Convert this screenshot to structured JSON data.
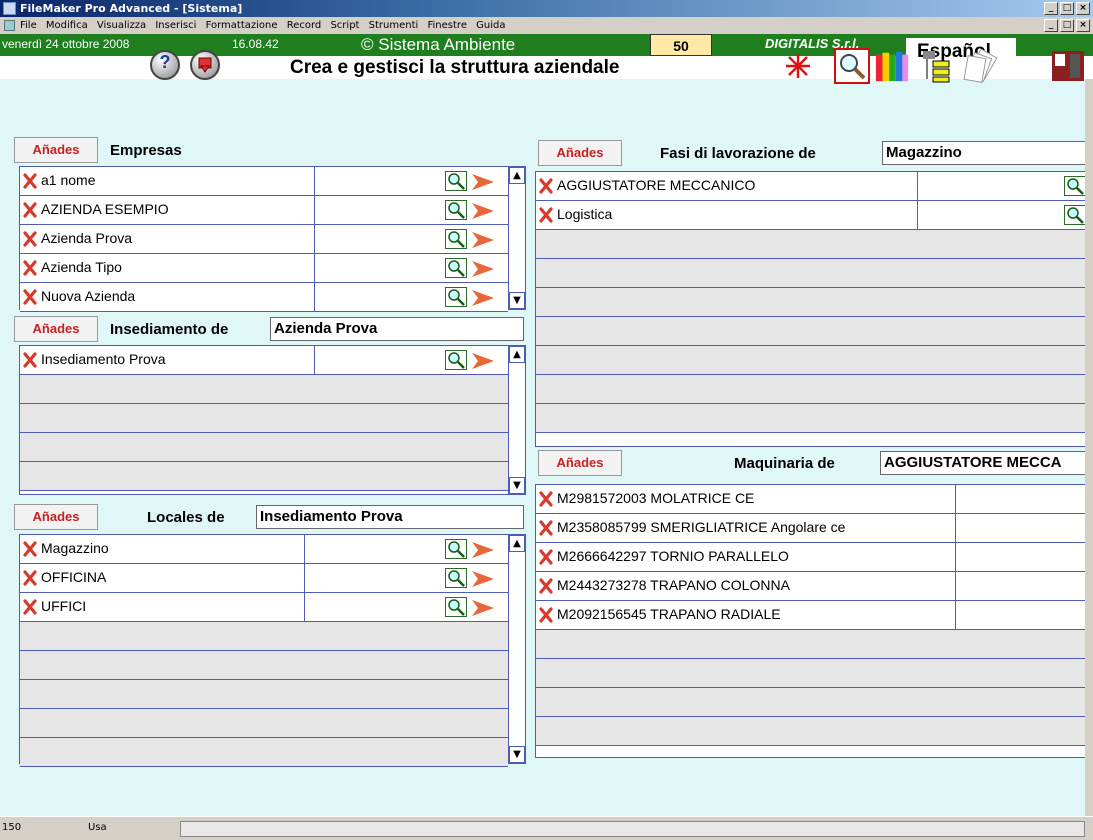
{
  "window": {
    "title": "FileMaker Pro Advanced - [Sistema]",
    "controls": [
      "_",
      "□",
      "×"
    ]
  },
  "menu": {
    "items": [
      "File",
      "Modifica",
      "Visualizza",
      "Inserisci",
      "Formattazione",
      "Record",
      "Script",
      "Strumenti",
      "Finestre",
      "Guida"
    ]
  },
  "header": {
    "date": "venerdì 24 ottobre 2008",
    "time": "16.08.42",
    "brand": "© Sistema Ambiente",
    "count": "50",
    "company": "DIGITALIS S.r.l.",
    "language": "Español",
    "heading": "Crea e gestisci la struttura aziendale",
    "help_symbol": "?",
    "colors": {
      "green": "#1f7f1f",
      "count_bg": "#ffe9a6",
      "accent_red": "#c62222",
      "panel_bg": "#dff7f7"
    },
    "toolbar_icons": [
      "help-icon",
      "exit-icon",
      "asterisk-icon",
      "search-icon",
      "books-icon",
      "tree-icon",
      "documents-icon",
      "calendar-icon"
    ]
  },
  "add_label": "Añades",
  "empresas": {
    "title": "Empresas",
    "rows": [
      "a1 nome",
      "AZIENDA ESEMPIO",
      "Azienda Prova",
      "Azienda Tipo",
      "Nuova Azienda"
    ]
  },
  "insediamento": {
    "title": "Insediamento de",
    "field": "Azienda Prova",
    "rows": [
      "Insediamento Prova"
    ]
  },
  "locales": {
    "title": "Locales de",
    "field": "Insediamento Prova",
    "rows": [
      "Magazzino",
      "OFFICINA",
      "UFFICI"
    ]
  },
  "fasi": {
    "title": "Fasi di lavorazione de",
    "field": "Magazzino",
    "rows": [
      "AGGIUSTATORE MECCANICO",
      "Logistica"
    ]
  },
  "maquinaria": {
    "title": "Maquinaria de",
    "field": "AGGIUSTATORE MECCA",
    "rows": [
      "M2981572003 MOLATRICE CE",
      "M2358085799 SMERIGLIATRICE Angolare ce",
      "M2666642297 TORNIO PARALLELO",
      "M2443273278 TRAPANO COLONNA",
      "M2092156545 TRAPANO RADIALE"
    ]
  },
  "status": {
    "zoom": "150",
    "mode": "Usa"
  }
}
